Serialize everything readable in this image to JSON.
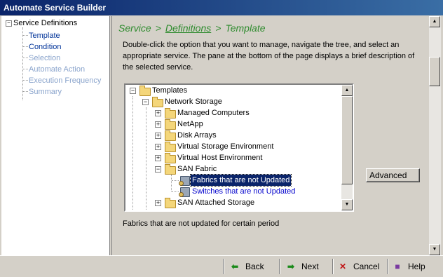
{
  "window": {
    "title": "Automate Service Builder"
  },
  "nav": {
    "root": "Service Definitions",
    "items": [
      {
        "label": "Template",
        "state": "active"
      },
      {
        "label": "Condition",
        "state": "active"
      },
      {
        "label": "Selection",
        "state": "inactive"
      },
      {
        "label": "Automate Action",
        "state": "inactive"
      },
      {
        "label": "Execution Frequency",
        "state": "inactive"
      },
      {
        "label": "Summary",
        "state": "inactive"
      }
    ]
  },
  "breadcrumb": {
    "part1": "Service",
    "sep1": ">",
    "part2": "Definitions",
    "sep2": ">",
    "part3": "Template"
  },
  "instructions": "Double-click the option that you want to manage, navigate the tree, and select an appropriate service. The pane at the bottom of the page displays a brief description of the selected service.",
  "tree": {
    "root": "Templates",
    "network_storage": "Network Storage",
    "children": [
      "Managed Computers",
      "NetApp",
      "Disk Arrays",
      "Virtual Storage Environment",
      "Virtual Host Environment",
      "SAN Fabric"
    ],
    "san_fabric_children": [
      "Fabrics that are not Updated",
      "Switches that are not Updated"
    ],
    "after": "SAN Attached Storage"
  },
  "description": "Fabrics that are not updated for certain period",
  "advanced_label": "Advanced",
  "buttons": {
    "back": "Back",
    "next": "Next",
    "cancel": "Cancel",
    "help": "Help"
  },
  "colors": {
    "title_bar": "#0a246a",
    "breadcrumb": "#2e8b2e",
    "selection": "#0a246a",
    "active_nav": "#003399",
    "inactive_nav": "#8aa4cc"
  }
}
